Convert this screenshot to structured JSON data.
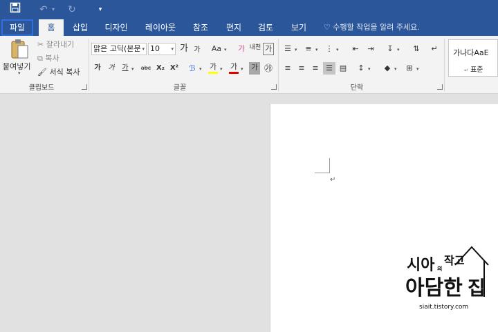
{
  "qat": {
    "save_icon": "save-icon",
    "undo_icon": "undo-icon",
    "redo_icon": "redo-icon",
    "customize_icon": "customize-icon"
  },
  "tabs": [
    {
      "label": "파일"
    },
    {
      "label": "홈"
    },
    {
      "label": "삽입"
    },
    {
      "label": "디자인"
    },
    {
      "label": "레이아웃"
    },
    {
      "label": "참조"
    },
    {
      "label": "편지"
    },
    {
      "label": "검토"
    },
    {
      "label": "보기"
    }
  ],
  "tell_me": "수행할 작업을 알려 주세요.",
  "clipboard": {
    "paste": "붙여넣기",
    "cut": "잘라내기",
    "copy": "복사",
    "format_painter": "서식 복사",
    "label": "클립보드"
  },
  "font": {
    "name": "맑은 고딕(본문",
    "size": "10",
    "grow": "가",
    "shrink": "가",
    "case": "Aa",
    "clear": "가",
    "phonetic": "내천",
    "border": "가",
    "bold": "가",
    "italic": "가",
    "underline": "가",
    "strike": "abc",
    "subscript": "X₂",
    "superscript": "X²",
    "highlight": "가",
    "color": "가",
    "shade": "가",
    "enclose": "㉮",
    "label": "글꼴"
  },
  "paragraph": {
    "label": "단락"
  },
  "styles": {
    "sample": "가나다AaE",
    "name": "표준"
  },
  "document": {
    "para_mark": "↵"
  },
  "watermark": {
    "line1": "시아",
    "small": "의",
    "line1b": "작고",
    "line2": "아담한",
    "house": "집",
    "url": "siait.tistory.com"
  },
  "colors": {
    "accent": "#2b579a",
    "highlight_yellow": "#ffff00",
    "font_red": "#e00000",
    "file_border": "#2f6fe0"
  }
}
